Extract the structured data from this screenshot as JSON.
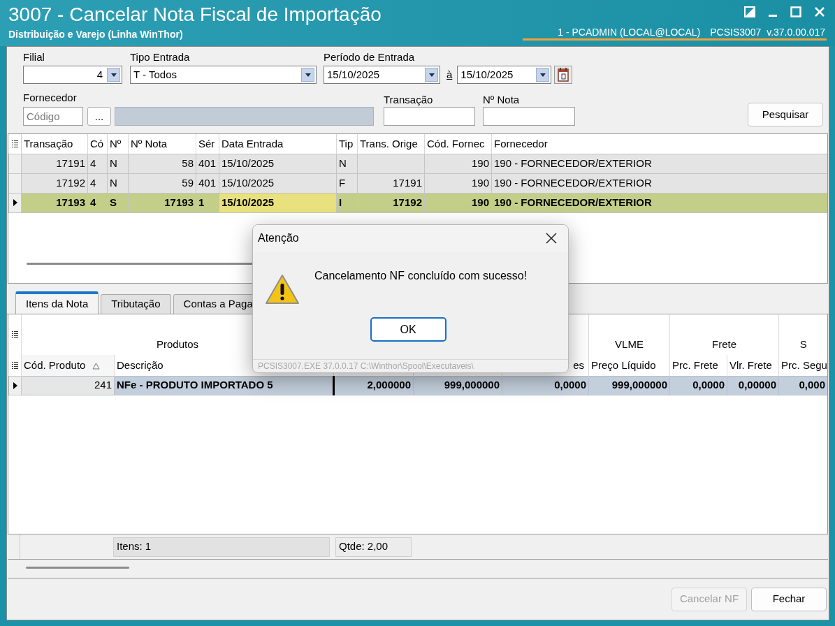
{
  "window": {
    "title": "3007 - Cancelar Nota Fiscal de Importação",
    "subtitle": "Distribuição e Varejo (Linha WinThor)",
    "user": "1 - PCADMIN (LOCAL@LOCAL)",
    "version": "PCSIS3007  v.37.0.00.017"
  },
  "filters": {
    "filial": {
      "label": "Filial",
      "value": "4"
    },
    "tipo_entrada": {
      "label": "Tipo Entrada",
      "value": "T - Todos"
    },
    "periodo": {
      "label": "Período de Entrada",
      "from": "15/10/2025",
      "separator": "à",
      "to": "15/10/2025"
    },
    "fornecedor": {
      "label": "Fornecedor",
      "placeholder": "Código",
      "browse": "..."
    },
    "transacao": {
      "label": "Transação"
    },
    "numero_nota": {
      "label": "Nº Nota"
    },
    "search_button": "Pesquisar"
  },
  "notes_table": {
    "columns": [
      "Transação",
      "Có",
      "Nº",
      "Nº Nota",
      "Sér",
      "Data Entrada",
      "Tip",
      "Trans. Orige",
      "Cód. Fornec",
      "Fornecedor"
    ],
    "rows": [
      {
        "cells": [
          "17191",
          "4",
          "N",
          "58",
          "401",
          "15/10/2025",
          "N",
          "",
          "190",
          "190 - FORNECEDOR/EXTERIOR"
        ],
        "selected": false,
        "focused": false
      },
      {
        "cells": [
          "17192",
          "4",
          "N",
          "59",
          "401",
          "15/10/2025",
          "F",
          "17191",
          "190",
          "190 - FORNECEDOR/EXTERIOR"
        ],
        "selected": false,
        "focused": false
      },
      {
        "cells": [
          "17193",
          "4",
          "S",
          "17193",
          "1",
          "15/10/2025",
          "I",
          "17192",
          "190",
          "190 - FORNECEDOR/EXTERIOR"
        ],
        "selected": true,
        "focused": true
      }
    ]
  },
  "tabs": [
    {
      "label": "Itens da Nota",
      "selected": true
    },
    {
      "label": "Tributação",
      "selected": false
    },
    {
      "label": "Contas a Paga",
      "selected": false
    }
  ],
  "items_table": {
    "groups": [
      {
        "label": "Produtos"
      },
      {
        "label": "VLME"
      },
      {
        "label": "Frete"
      },
      {
        "label": "S"
      }
    ],
    "columns": [
      {
        "label": "Cód. Produto",
        "sorted": true
      },
      {
        "label": "Descrição",
        "sorted": false
      },
      null,
      null,
      {
        "label": "es",
        "sorted": false
      },
      {
        "label": "Preço Líquido",
        "sorted": false
      },
      {
        "label": "Prc. Frete",
        "sorted": false
      },
      {
        "label": "Vlr. Frete",
        "sorted": false
      },
      {
        "label": "Prc. Segu",
        "sorted": false
      }
    ],
    "rows": [
      {
        "cells": [
          "241",
          "NFe - PRODUTO IMPORTADO 5",
          "2,000000",
          "999,000000",
          "0,0000",
          "999,000000",
          "0,0000",
          "0,00000",
          "0,000"
        ],
        "selected": true
      }
    ]
  },
  "footer": {
    "items": "Itens: 1",
    "quantity": "Qtde: 2,00"
  },
  "buttons": [
    {
      "label": "Cancelar NF",
      "disabled": true
    },
    {
      "label": "Fechar",
      "disabled": false
    }
  ],
  "dialog": {
    "title": "Atenção",
    "message": "Cancelamento NF concluído com sucesso!",
    "ok": "OK",
    "status": "PCSIS3007.EXE 37.0.0.17 C:\\Winthor\\Spool\\Executaveis\\"
  }
}
